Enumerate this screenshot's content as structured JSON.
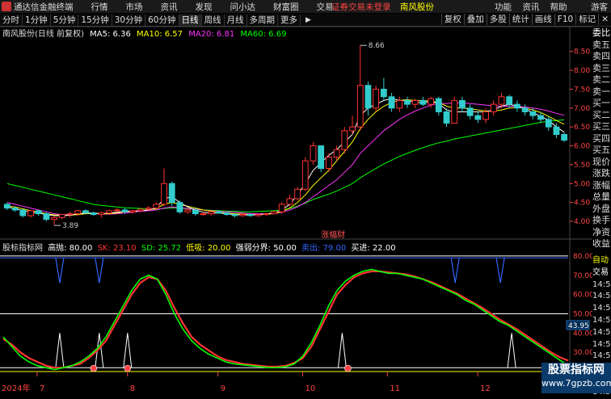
{
  "titlebar": {
    "app_name": "通达信金融终端",
    "menus": [
      "行情",
      "市场",
      "资讯",
      "发现",
      "问小达",
      "财富圈",
      "交易"
    ],
    "notice": "证券交易未登录",
    "stock_name": "南风股份",
    "right_items": [
      "功能",
      "资讯",
      "帮助",
      "游客"
    ]
  },
  "periods": [
    "分时",
    "1分钟",
    "5分钟",
    "15分钟",
    "30分钟",
    "60分钟",
    "日线",
    "周线",
    "月线",
    "多周期",
    "更多"
  ],
  "active_period": "日线",
  "right_tabs": [
    "复权",
    "叠加",
    "多股",
    "统计",
    "画线",
    "F10",
    "标记"
  ],
  "chart_info": {
    "title": "南风股份(日线 前复权)",
    "ma": [
      {
        "label": "MA5: 6.36",
        "color": "#ffffff"
      },
      {
        "label": "MA10: 6.57",
        "color": "#ffff00"
      },
      {
        "label": "MA20: 6.81",
        "color": "#ff33ff"
      },
      {
        "label": "MA60: 6.69",
        "color": "#00ff00"
      }
    ]
  },
  "price_axis": [
    "8.50",
    "8.00",
    "7.50",
    "7.00",
    "6.50",
    "6.00",
    "5.50",
    "5.00",
    "4.50",
    "4.00"
  ],
  "price_annotations": {
    "high": "8.66",
    "low": "3.89",
    "boost": "涨幅财"
  },
  "indicator_info": {
    "name": "股标指标网",
    "items": [
      {
        "label": "高抛: 80.00",
        "color": "#ffffff"
      },
      {
        "label": "SK: 23.10",
        "color": "#ff3333"
      },
      {
        "label": "SD: 25.72",
        "color": "#00ff00"
      },
      {
        "label": "低吸: 20.00",
        "color": "#ffff00"
      },
      {
        "label": "强弱分界: 50.00",
        "color": "#ffffff"
      },
      {
        "label": "卖出: 79.00",
        "color": "#3366ff"
      },
      {
        "label": "买进: 22.00",
        "color": "#ffffff"
      }
    ]
  },
  "ind_axis": [
    "80.00",
    "70.00",
    "60.00",
    "50.00",
    "40.00",
    "30.00"
  ],
  "ind_value": "43.95",
  "orderbook": [
    {
      "t": "委比",
      "c": "#ffffff"
    },
    {
      "t": "卖五",
      "c": "#dddddd"
    },
    {
      "t": "卖四",
      "c": "#dddddd"
    },
    {
      "t": "卖三",
      "c": "#dddddd"
    },
    {
      "t": "卖二",
      "c": "#dddddd"
    },
    {
      "t": "卖一",
      "c": "#dddddd"
    },
    {
      "t": "买一",
      "c": "#dddddd"
    },
    {
      "t": "买二",
      "c": "#dddddd"
    },
    {
      "t": "买三",
      "c": "#dddddd"
    },
    {
      "t": "买四",
      "c": "#dddddd"
    },
    {
      "t": "买五",
      "c": "#dddddd"
    },
    {
      "t": "现价",
      "c": "#dddddd"
    },
    {
      "t": "涨跌",
      "c": "#dddddd"
    },
    {
      "t": "涨幅",
      "c": "#dddddd"
    },
    {
      "t": "总量",
      "c": "#dddddd"
    },
    {
      "t": "外盘",
      "c": "#dddddd"
    },
    {
      "t": "换手",
      "c": "#dddddd"
    },
    {
      "t": "净资",
      "c": "#dddddd"
    },
    {
      "t": "收益",
      "c": "#dddddd"
    }
  ],
  "time_col": [
    {
      "t": "自动",
      "c": "#ffff00"
    },
    {
      "t": "交易",
      "c": "#ffffff"
    },
    {
      "t": "14:50",
      "c": "#dddddd"
    },
    {
      "t": "14:50",
      "c": "#dddddd"
    },
    {
      "t": "14:50",
      "c": "#dddddd"
    },
    {
      "t": "14:50",
      "c": "#dddddd"
    },
    {
      "t": "14:50",
      "c": "#dddddd"
    },
    {
      "t": "14:50",
      "c": "#dddddd"
    },
    {
      "t": "14:50",
      "c": "#dddddd"
    },
    {
      "t": "14:50",
      "c": "#dddddd"
    },
    {
      "t": "14:50",
      "c": "#dddddd"
    },
    {
      "t": "14:50",
      "c": "#dddddd"
    }
  ],
  "date_axis": {
    "year": "2024年",
    "months": [
      "7",
      "8",
      "9",
      "10",
      "11",
      "12"
    ]
  },
  "watermark": {
    "line1": "股票指标网",
    "line2": "www.7gpzb.com"
  },
  "chart_data": {
    "type": "candlestick",
    "y_range": [
      3.7,
      8.9
    ],
    "y_ticks": [
      8.5,
      8.0,
      7.5,
      7.0,
      6.5,
      6.0,
      5.5,
      5.0,
      4.5,
      4.0
    ],
    "high": 8.66,
    "low": 3.89,
    "candles": [
      [
        4.45,
        4.5,
        4.3,
        4.35
      ],
      [
        4.35,
        4.4,
        4.25,
        4.3
      ],
      [
        4.3,
        4.32,
        4.1,
        4.15
      ],
      [
        4.15,
        4.3,
        4.1,
        4.28
      ],
      [
        4.28,
        4.3,
        4.15,
        4.2
      ],
      [
        4.2,
        4.25,
        4.0,
        4.05
      ],
      [
        4.05,
        4.15,
        3.89,
        4.1
      ],
      [
        4.1,
        4.2,
        4.05,
        4.18
      ],
      [
        4.18,
        4.25,
        4.1,
        4.2
      ],
      [
        4.2,
        4.3,
        4.15,
        4.28
      ],
      [
        4.28,
        4.32,
        4.2,
        4.22
      ],
      [
        4.22,
        4.26,
        4.15,
        4.18
      ],
      [
        4.18,
        4.25,
        4.1,
        4.22
      ],
      [
        4.22,
        4.3,
        4.2,
        4.28
      ],
      [
        4.28,
        4.35,
        4.25,
        4.3
      ],
      [
        4.3,
        4.35,
        4.2,
        4.25
      ],
      [
        4.25,
        4.3,
        4.2,
        4.28
      ],
      [
        4.28,
        4.35,
        4.25,
        4.32
      ],
      [
        4.32,
        4.4,
        4.28,
        4.35
      ],
      [
        4.35,
        4.5,
        4.3,
        4.45
      ],
      [
        4.45,
        5.4,
        4.4,
        5.0
      ],
      [
        5.0,
        5.05,
        4.4,
        4.5
      ],
      [
        4.5,
        4.55,
        4.2,
        4.25
      ],
      [
        4.25,
        4.35,
        4.2,
        4.3
      ],
      [
        4.3,
        4.35,
        4.15,
        4.2
      ],
      [
        4.2,
        4.25,
        4.15,
        4.2
      ],
      [
        4.2,
        4.28,
        4.15,
        4.25
      ],
      [
        4.25,
        4.3,
        4.2,
        4.22
      ],
      [
        4.22,
        4.25,
        4.15,
        4.18
      ],
      [
        4.18,
        4.22,
        4.1,
        4.15
      ],
      [
        4.15,
        4.2,
        4.12,
        4.18
      ],
      [
        4.18,
        4.22,
        4.12,
        4.15
      ],
      [
        4.15,
        4.2,
        4.12,
        4.18
      ],
      [
        4.18,
        4.22,
        4.15,
        4.2
      ],
      [
        4.2,
        4.28,
        4.18,
        4.25
      ],
      [
        4.25,
        4.5,
        4.2,
        4.45
      ],
      [
        4.45,
        4.7,
        4.4,
        4.6
      ],
      [
        4.6,
        4.9,
        4.55,
        4.85
      ],
      [
        4.85,
        5.7,
        4.8,
        5.6
      ],
      [
        5.6,
        6.1,
        5.5,
        6.0
      ],
      [
        6.0,
        6.0,
        5.3,
        5.4
      ],
      [
        5.4,
        5.8,
        5.3,
        5.7
      ],
      [
        5.7,
        6.0,
        5.6,
        5.9
      ],
      [
        5.9,
        6.5,
        5.8,
        6.4
      ],
      [
        6.4,
        6.8,
        6.3,
        6.5
      ],
      [
        6.5,
        8.66,
        6.4,
        7.6
      ],
      [
        7.6,
        7.7,
        6.8,
        7.0
      ],
      [
        7.0,
        7.6,
        6.9,
        7.5
      ],
      [
        7.5,
        7.8,
        7.2,
        7.3
      ],
      [
        7.3,
        7.4,
        6.9,
        7.0
      ],
      [
        7.0,
        7.3,
        6.9,
        7.2
      ],
      [
        7.2,
        7.3,
        7.0,
        7.1
      ],
      [
        7.1,
        7.25,
        7.0,
        7.2
      ],
      [
        7.2,
        7.3,
        7.05,
        7.1
      ],
      [
        7.1,
        7.3,
        7.0,
        7.25
      ],
      [
        7.25,
        7.3,
        6.8,
        6.9
      ],
      [
        6.9,
        7.0,
        6.5,
        6.6
      ],
      [
        6.6,
        7.3,
        6.6,
        7.2
      ],
      [
        7.2,
        7.3,
        6.9,
        7.0
      ],
      [
        7.0,
        7.1,
        6.7,
        6.8
      ],
      [
        6.8,
        6.9,
        6.6,
        6.7
      ],
      [
        6.7,
        7.0,
        6.6,
        6.9
      ],
      [
        6.9,
        7.2,
        6.8,
        7.1
      ],
      [
        7.1,
        7.4,
        7.0,
        7.3
      ],
      [
        7.3,
        7.35,
        7.0,
        7.1
      ],
      [
        7.1,
        7.2,
        6.9,
        7.0
      ],
      [
        7.0,
        7.1,
        6.8,
        6.9
      ],
      [
        6.9,
        7.0,
        6.7,
        6.8
      ],
      [
        6.8,
        6.9,
        6.6,
        6.7
      ],
      [
        6.7,
        6.8,
        6.4,
        6.5
      ],
      [
        6.5,
        6.6,
        6.2,
        6.3
      ],
      [
        6.3,
        6.35,
        6.1,
        6.15
      ]
    ],
    "ma_series": [
      {
        "name": "MA60",
        "color": "#00ff00",
        "values": [
          5.0,
          4.95,
          4.9,
          4.85,
          4.8,
          4.75,
          4.7,
          4.65,
          4.6,
          4.55,
          4.5,
          4.45,
          4.42,
          4.4,
          4.38,
          4.36,
          4.35,
          4.34,
          4.33,
          4.32,
          4.34,
          4.36,
          4.35,
          4.33,
          4.32,
          4.3,
          4.29,
          4.28,
          4.27,
          4.26,
          4.25,
          4.25,
          4.26,
          4.27,
          4.28,
          4.3,
          4.34,
          4.4,
          4.48,
          4.58,
          4.65,
          4.72,
          4.8,
          4.9,
          5.0,
          5.15,
          5.28,
          5.4,
          5.52,
          5.62,
          5.72,
          5.8,
          5.88,
          5.95,
          6.02,
          6.08,
          6.12,
          6.18,
          6.22,
          6.26,
          6.3,
          6.34,
          6.38,
          6.42,
          6.46,
          6.5,
          6.54,
          6.58,
          6.62,
          6.65,
          6.67,
          6.69
        ]
      },
      {
        "name": "MA20",
        "color": "#ff33ff",
        "values": [
          4.5,
          4.45,
          4.4,
          4.35,
          4.3,
          4.25,
          4.2,
          4.18,
          4.17,
          4.18,
          4.2,
          4.22,
          4.2,
          4.19,
          4.2,
          4.22,
          4.24,
          4.26,
          4.28,
          4.3,
          4.35,
          4.38,
          4.36,
          4.34,
          4.32,
          4.3,
          4.28,
          4.26,
          4.25,
          4.24,
          4.22,
          4.2,
          4.2,
          4.2,
          4.21,
          4.24,
          4.3,
          4.38,
          4.5,
          4.65,
          4.8,
          4.95,
          5.1,
          5.3,
          5.5,
          5.8,
          6.0,
          6.2,
          6.4,
          6.55,
          6.7,
          6.82,
          6.92,
          7.0,
          7.08,
          7.12,
          7.12,
          7.14,
          7.14,
          7.12,
          7.1,
          7.08,
          7.06,
          7.05,
          7.05,
          7.05,
          7.03,
          7.0,
          6.97,
          6.92,
          6.86,
          6.81
        ]
      },
      {
        "name": "MA10",
        "color": "#ffff00",
        "values": [
          4.4,
          4.38,
          4.33,
          4.28,
          4.24,
          4.2,
          4.17,
          4.16,
          4.16,
          4.18,
          4.2,
          4.21,
          4.2,
          4.2,
          4.22,
          4.25,
          4.26,
          4.28,
          4.3,
          4.34,
          4.45,
          4.5,
          4.45,
          4.4,
          4.35,
          4.3,
          4.27,
          4.24,
          4.22,
          4.2,
          4.19,
          4.18,
          4.18,
          4.19,
          4.2,
          4.25,
          4.35,
          4.5,
          4.7,
          4.95,
          5.15,
          5.35,
          5.6,
          5.85,
          6.1,
          6.45,
          6.7,
          6.9,
          7.05,
          7.15,
          7.2,
          7.22,
          7.2,
          7.2,
          7.18,
          7.15,
          7.05,
          7.0,
          7.0,
          6.98,
          6.95,
          6.92,
          6.92,
          6.95,
          7.0,
          7.02,
          7.0,
          6.95,
          6.88,
          6.78,
          6.67,
          6.57
        ]
      },
      {
        "name": "MA5",
        "color": "#ffffff",
        "values": [
          4.38,
          4.34,
          4.28,
          4.24,
          4.22,
          4.18,
          4.15,
          4.15,
          4.16,
          4.2,
          4.22,
          4.22,
          4.2,
          4.22,
          4.24,
          4.26,
          4.27,
          4.28,
          4.3,
          4.35,
          4.6,
          4.65,
          4.5,
          4.38,
          4.3,
          4.24,
          4.22,
          4.22,
          4.2,
          4.18,
          4.17,
          4.17,
          4.18,
          4.2,
          4.22,
          4.3,
          4.45,
          4.7,
          5.0,
          5.35,
          5.55,
          5.75,
          5.9,
          6.1,
          6.3,
          6.8,
          7.0,
          7.1,
          7.2,
          7.25,
          7.2,
          7.2,
          7.15,
          7.15,
          7.17,
          7.12,
          6.95,
          6.9,
          6.9,
          6.9,
          6.9,
          6.9,
          6.95,
          7.05,
          7.1,
          7.05,
          6.98,
          6.88,
          6.78,
          6.68,
          6.5,
          6.36
        ]
      }
    ],
    "indicator": {
      "y_range": [
        20,
        85
      ],
      "levels": {
        "high": 80.0,
        "low": 20.0,
        "mid": 50.0,
        "sell": 79.0,
        "buy": 22.0
      },
      "sk": [
        38,
        33,
        28,
        25,
        23,
        22,
        21,
        22,
        23,
        25,
        28,
        32,
        38,
        46,
        54,
        62,
        68,
        70,
        68,
        60,
        50,
        42,
        36,
        32,
        29,
        27,
        25,
        24,
        23.5,
        23,
        22.5,
        22,
        22,
        22.5,
        24,
        28,
        35,
        44,
        54,
        62,
        67,
        70,
        72,
        73,
        72,
        71,
        71,
        70,
        69,
        68,
        66,
        64,
        62,
        60,
        57,
        55,
        52,
        49,
        46,
        44,
        41,
        38,
        35,
        32,
        29,
        26,
        23.1
      ],
      "sd": [
        37,
        34,
        30,
        27,
        25,
        23,
        22,
        22,
        23,
        24,
        27,
        31,
        36,
        44,
        52,
        60,
        66,
        69,
        68,
        62,
        53,
        45,
        38,
        34,
        31,
        28,
        26,
        25,
        24,
        23.5,
        23,
        22.5,
        22.5,
        23,
        24.5,
        27,
        33,
        42,
        51,
        60,
        65,
        69,
        71,
        72,
        72,
        71.5,
        71,
        70.5,
        69.5,
        68,
        66.5,
        64.5,
        62.5,
        60.5,
        58,
        55.5,
        53,
        50,
        47,
        44.5,
        42,
        39,
        36,
        33,
        30,
        27.5,
        25.72
      ],
      "buy_spikes": [
        0.1,
        0.17,
        0.22,
        0.6,
        0.9
      ],
      "sell_dips": [
        0.1,
        0.17,
        0.8,
        0.88
      ],
      "red_dots": [
        0.16,
        0.22,
        0.61
      ]
    }
  }
}
